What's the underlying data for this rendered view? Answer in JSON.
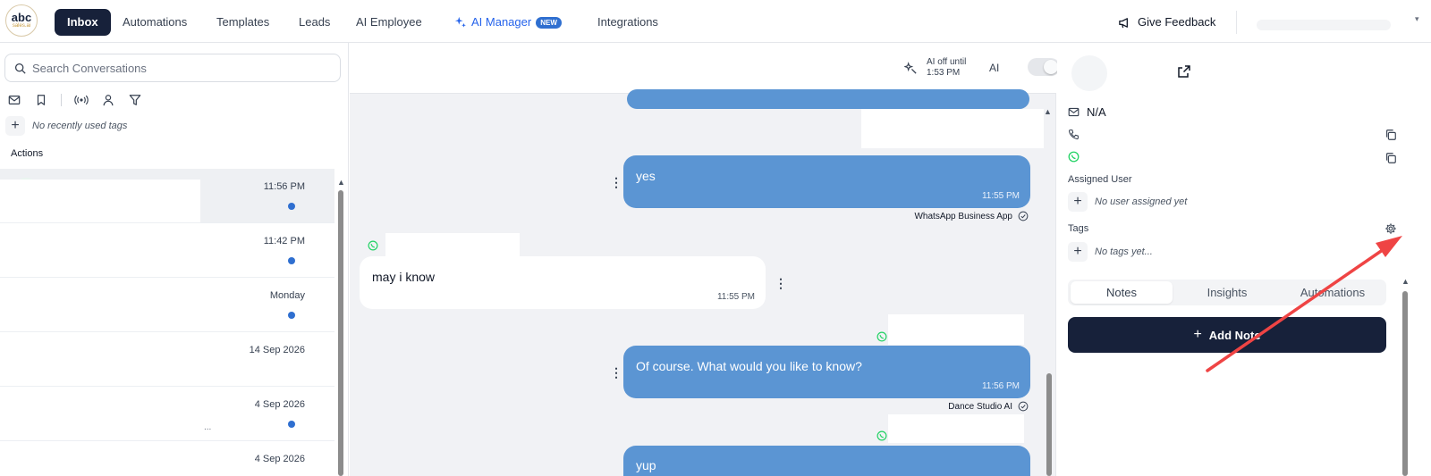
{
  "logo": {
    "line1": "abc",
    "line2": "sales.ai"
  },
  "nav": {
    "tabs": [
      {
        "label": "Inbox"
      },
      {
        "label": "Automations"
      },
      {
        "label": "Templates"
      },
      {
        "label": "Leads"
      },
      {
        "label": "AI Employee"
      },
      {
        "label": "AI Manager",
        "badge": "NEW"
      },
      {
        "label": "Integrations"
      }
    ],
    "feedback_label": "Give Feedback"
  },
  "sidebar": {
    "search_placeholder": "Search Conversations",
    "no_tags": "No recently used tags",
    "actions_label": "Actions",
    "conversations": [
      {
        "time": "11:56 PM",
        "unread": true
      },
      {
        "time": "11:42 PM",
        "unread": true
      },
      {
        "time": "Monday",
        "unread": true
      },
      {
        "time": "14 Sep 2026",
        "unread": false
      },
      {
        "time": "4 Sep 2026",
        "unread": true,
        "ellipsis": "..."
      },
      {
        "time": "4 Sep 2026",
        "unread": false
      }
    ]
  },
  "chat": {
    "ai_status": {
      "text": "AI off until 1:53 PM",
      "label": "AI",
      "enabled": false
    },
    "messages": [
      {
        "direction": "out",
        "text": "yes",
        "time": "11:55 PM",
        "sender": "WhatsApp Business App"
      },
      {
        "direction": "in",
        "text": "may i know",
        "time": "11:55 PM"
      },
      {
        "direction": "out",
        "text": "Of course. What would you like to know?",
        "time": "11:56 PM",
        "sender": "Dance Studio AI"
      },
      {
        "direction": "out",
        "text": "yup"
      }
    ]
  },
  "details": {
    "email": "N/A",
    "assigned_user_label": "Assigned User",
    "no_user": "No user assigned yet",
    "tags_label": "Tags",
    "no_tags": "No tags yet...",
    "tabs": [
      {
        "label": "Notes"
      },
      {
        "label": "Insights"
      },
      {
        "label": "Automations"
      }
    ],
    "active_tab": "Notes",
    "add_note_label": "Add Note"
  },
  "colors": {
    "nav_active": "#17213a",
    "bubble_out": "#5b95d3",
    "unread_dot": "#2f6fd0",
    "whatsapp": "#25d366",
    "annotation_arrow": "#ef4444"
  }
}
